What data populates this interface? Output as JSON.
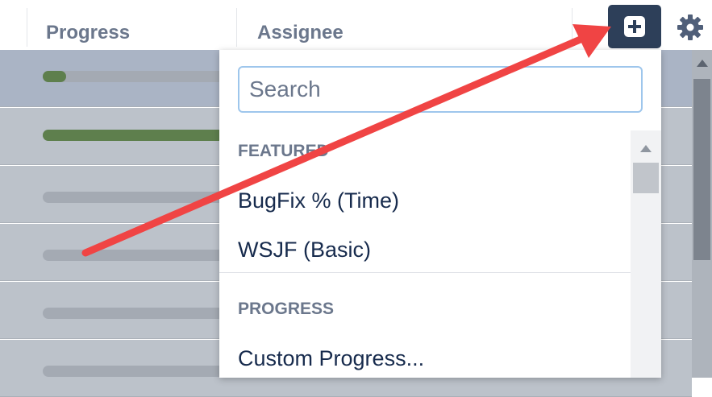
{
  "header": {
    "columns": [
      {
        "label": "Progress"
      },
      {
        "label": "Assignee"
      }
    ],
    "add_button_icon": "plus-square-icon",
    "settings_icon": "gear-icon"
  },
  "rows": [
    {
      "progress": 0.13,
      "selected": true
    },
    {
      "progress": 1.0,
      "selected": false
    },
    {
      "progress": 0.0,
      "selected": false
    },
    {
      "progress": 0.0,
      "selected": false
    },
    {
      "progress": 0.0,
      "selected": false
    },
    {
      "progress": 0.0,
      "selected": false
    }
  ],
  "dropdown": {
    "search_placeholder": "Search",
    "sections": [
      {
        "heading": "FEATURED",
        "items": [
          "BugFix % (Time)",
          "WSJF (Basic)"
        ]
      },
      {
        "heading": "PROGRESS",
        "items": [
          "Custom Progress..."
        ]
      }
    ]
  },
  "annotation": {
    "arrow_icon": "red-arrow-icon",
    "color": "#f04444"
  },
  "colors": {
    "header_button": "#2d3f59",
    "progress_fill": "#5e7f4d",
    "row_background": "#bcc2ca",
    "search_border": "#9ec6ec"
  }
}
